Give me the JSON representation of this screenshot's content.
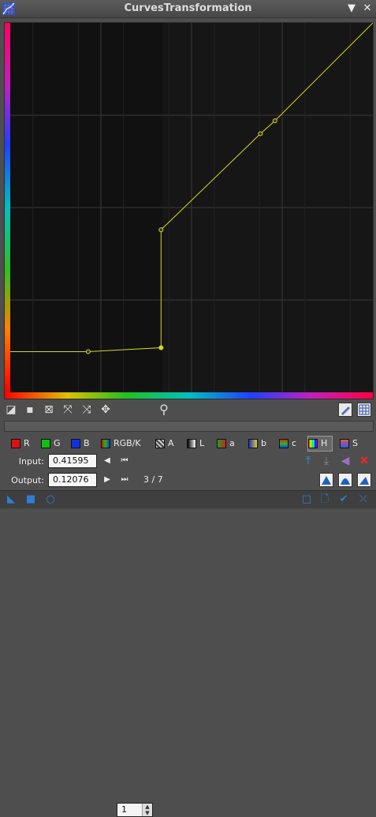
{
  "window": {
    "title": "CurvesTransformation"
  },
  "titlebar_buttons": {
    "pin": "✕̲",
    "close": "✕"
  },
  "toolbar": {
    "zoom_value": "1"
  },
  "channels": [
    {
      "label": "R",
      "color": "#e01010"
    },
    {
      "label": "G",
      "color": "#10c010"
    },
    {
      "label": "B",
      "color": "#1030e0"
    },
    {
      "label": "RGB/K",
      "color": "#888888"
    },
    {
      "label": "A",
      "color": "#cccccc"
    },
    {
      "label": "L",
      "color": "#dddddd"
    },
    {
      "label": "a",
      "color": "#d04040"
    },
    {
      "label": "b",
      "color": "#d0c020"
    },
    {
      "label": "c",
      "color": "#50a050"
    },
    {
      "label": "H",
      "color": "#c04080"
    },
    {
      "label": "S",
      "color": "#8050c0"
    }
  ],
  "active_channel": "H",
  "input": {
    "label": "Input:",
    "value": "0.41595"
  },
  "output": {
    "label": "Output:",
    "value": "0.12076"
  },
  "point_counter": "3 / 7",
  "curve": {
    "points": [
      [
        0.0,
        0.11
      ],
      [
        0.215,
        0.11
      ],
      [
        0.41595,
        0.12076
      ],
      [
        0.41595,
        0.44
      ],
      [
        0.69,
        0.7
      ],
      [
        0.73,
        0.735
      ],
      [
        1.0,
        1.0
      ]
    ],
    "curve_color": "#d8d820"
  }
}
